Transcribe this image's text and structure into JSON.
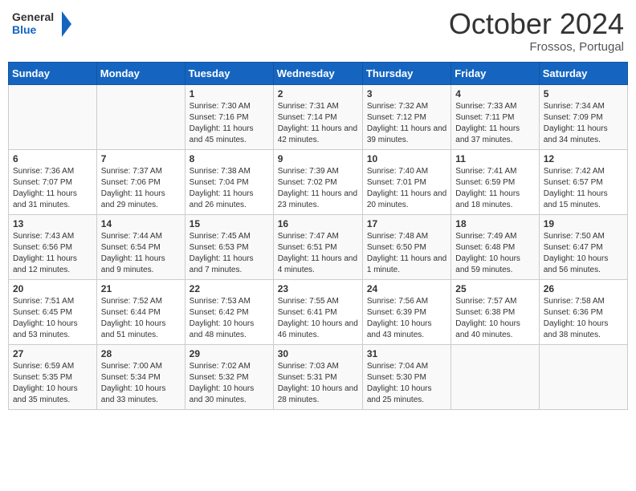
{
  "header": {
    "logo_line1": "General",
    "logo_line2": "Blue",
    "month_year": "October 2024",
    "location": "Frossos, Portugal"
  },
  "days_of_week": [
    "Sunday",
    "Monday",
    "Tuesday",
    "Wednesday",
    "Thursday",
    "Friday",
    "Saturday"
  ],
  "weeks": [
    [
      {
        "day": "",
        "info": ""
      },
      {
        "day": "",
        "info": ""
      },
      {
        "day": "1",
        "info": "Sunrise: 7:30 AM\nSunset: 7:16 PM\nDaylight: 11 hours and 45 minutes."
      },
      {
        "day": "2",
        "info": "Sunrise: 7:31 AM\nSunset: 7:14 PM\nDaylight: 11 hours and 42 minutes."
      },
      {
        "day": "3",
        "info": "Sunrise: 7:32 AM\nSunset: 7:12 PM\nDaylight: 11 hours and 39 minutes."
      },
      {
        "day": "4",
        "info": "Sunrise: 7:33 AM\nSunset: 7:11 PM\nDaylight: 11 hours and 37 minutes."
      },
      {
        "day": "5",
        "info": "Sunrise: 7:34 AM\nSunset: 7:09 PM\nDaylight: 11 hours and 34 minutes."
      }
    ],
    [
      {
        "day": "6",
        "info": "Sunrise: 7:36 AM\nSunset: 7:07 PM\nDaylight: 11 hours and 31 minutes."
      },
      {
        "day": "7",
        "info": "Sunrise: 7:37 AM\nSunset: 7:06 PM\nDaylight: 11 hours and 29 minutes."
      },
      {
        "day": "8",
        "info": "Sunrise: 7:38 AM\nSunset: 7:04 PM\nDaylight: 11 hours and 26 minutes."
      },
      {
        "day": "9",
        "info": "Sunrise: 7:39 AM\nSunset: 7:02 PM\nDaylight: 11 hours and 23 minutes."
      },
      {
        "day": "10",
        "info": "Sunrise: 7:40 AM\nSunset: 7:01 PM\nDaylight: 11 hours and 20 minutes."
      },
      {
        "day": "11",
        "info": "Sunrise: 7:41 AM\nSunset: 6:59 PM\nDaylight: 11 hours and 18 minutes."
      },
      {
        "day": "12",
        "info": "Sunrise: 7:42 AM\nSunset: 6:57 PM\nDaylight: 11 hours and 15 minutes."
      }
    ],
    [
      {
        "day": "13",
        "info": "Sunrise: 7:43 AM\nSunset: 6:56 PM\nDaylight: 11 hours and 12 minutes."
      },
      {
        "day": "14",
        "info": "Sunrise: 7:44 AM\nSunset: 6:54 PM\nDaylight: 11 hours and 9 minutes."
      },
      {
        "day": "15",
        "info": "Sunrise: 7:45 AM\nSunset: 6:53 PM\nDaylight: 11 hours and 7 minutes."
      },
      {
        "day": "16",
        "info": "Sunrise: 7:47 AM\nSunset: 6:51 PM\nDaylight: 11 hours and 4 minutes."
      },
      {
        "day": "17",
        "info": "Sunrise: 7:48 AM\nSunset: 6:50 PM\nDaylight: 11 hours and 1 minute."
      },
      {
        "day": "18",
        "info": "Sunrise: 7:49 AM\nSunset: 6:48 PM\nDaylight: 10 hours and 59 minutes."
      },
      {
        "day": "19",
        "info": "Sunrise: 7:50 AM\nSunset: 6:47 PM\nDaylight: 10 hours and 56 minutes."
      }
    ],
    [
      {
        "day": "20",
        "info": "Sunrise: 7:51 AM\nSunset: 6:45 PM\nDaylight: 10 hours and 53 minutes."
      },
      {
        "day": "21",
        "info": "Sunrise: 7:52 AM\nSunset: 6:44 PM\nDaylight: 10 hours and 51 minutes."
      },
      {
        "day": "22",
        "info": "Sunrise: 7:53 AM\nSunset: 6:42 PM\nDaylight: 10 hours and 48 minutes."
      },
      {
        "day": "23",
        "info": "Sunrise: 7:55 AM\nSunset: 6:41 PM\nDaylight: 10 hours and 46 minutes."
      },
      {
        "day": "24",
        "info": "Sunrise: 7:56 AM\nSunset: 6:39 PM\nDaylight: 10 hours and 43 minutes."
      },
      {
        "day": "25",
        "info": "Sunrise: 7:57 AM\nSunset: 6:38 PM\nDaylight: 10 hours and 40 minutes."
      },
      {
        "day": "26",
        "info": "Sunrise: 7:58 AM\nSunset: 6:36 PM\nDaylight: 10 hours and 38 minutes."
      }
    ],
    [
      {
        "day": "27",
        "info": "Sunrise: 6:59 AM\nSunset: 5:35 PM\nDaylight: 10 hours and 35 minutes."
      },
      {
        "day": "28",
        "info": "Sunrise: 7:00 AM\nSunset: 5:34 PM\nDaylight: 10 hours and 33 minutes."
      },
      {
        "day": "29",
        "info": "Sunrise: 7:02 AM\nSunset: 5:32 PM\nDaylight: 10 hours and 30 minutes."
      },
      {
        "day": "30",
        "info": "Sunrise: 7:03 AM\nSunset: 5:31 PM\nDaylight: 10 hours and 28 minutes."
      },
      {
        "day": "31",
        "info": "Sunrise: 7:04 AM\nSunset: 5:30 PM\nDaylight: 10 hours and 25 minutes."
      },
      {
        "day": "",
        "info": ""
      },
      {
        "day": "",
        "info": ""
      }
    ]
  ]
}
